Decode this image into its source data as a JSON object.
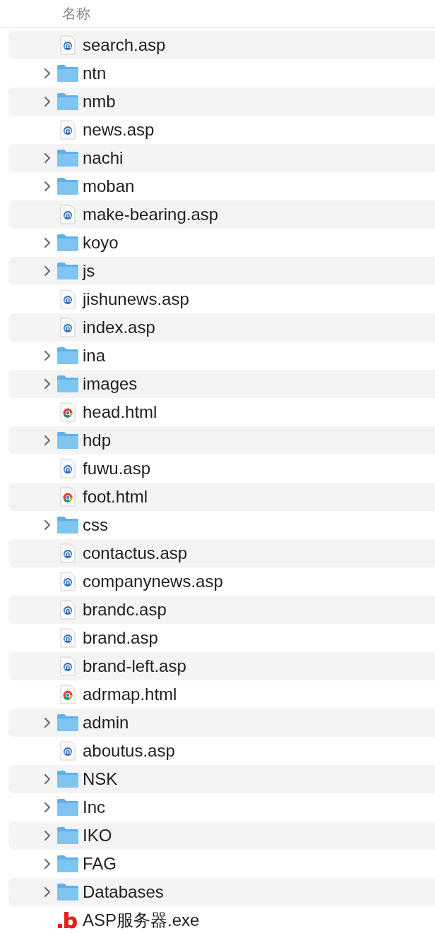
{
  "header": {
    "name_column": "名称"
  },
  "files": [
    {
      "name": "search.asp",
      "kind": "asp"
    },
    {
      "name": "ntn",
      "kind": "folder"
    },
    {
      "name": "nmb",
      "kind": "folder"
    },
    {
      "name": "news.asp",
      "kind": "asp"
    },
    {
      "name": "nachi",
      "kind": "folder"
    },
    {
      "name": "moban",
      "kind": "folder"
    },
    {
      "name": "make-bearing.asp",
      "kind": "asp"
    },
    {
      "name": "koyo",
      "kind": "folder"
    },
    {
      "name": "js",
      "kind": "folder"
    },
    {
      "name": "jishunews.asp",
      "kind": "asp"
    },
    {
      "name": "index.asp",
      "kind": "asp"
    },
    {
      "name": "ina",
      "kind": "folder"
    },
    {
      "name": "images",
      "kind": "folder"
    },
    {
      "name": "head.html",
      "kind": "html"
    },
    {
      "name": "hdp",
      "kind": "folder"
    },
    {
      "name": "fuwu.asp",
      "kind": "asp"
    },
    {
      "name": "foot.html",
      "kind": "html"
    },
    {
      "name": "css",
      "kind": "folder"
    },
    {
      "name": "contactus.asp",
      "kind": "asp"
    },
    {
      "name": "companynews.asp",
      "kind": "asp"
    },
    {
      "name": "brandc.asp",
      "kind": "asp"
    },
    {
      "name": "brand.asp",
      "kind": "asp"
    },
    {
      "name": "brand-left.asp",
      "kind": "asp"
    },
    {
      "name": "adrmap.html",
      "kind": "html"
    },
    {
      "name": "admin",
      "kind": "folder"
    },
    {
      "name": "aboutus.asp",
      "kind": "asp"
    },
    {
      "name": "NSK",
      "kind": "folder"
    },
    {
      "name": "Inc",
      "kind": "folder"
    },
    {
      "name": "IKO",
      "kind": "folder"
    },
    {
      "name": "FAG",
      "kind": "folder"
    },
    {
      "name": "Databases",
      "kind": "folder"
    },
    {
      "name": "ASP服务器.exe",
      "kind": "exe"
    }
  ]
}
